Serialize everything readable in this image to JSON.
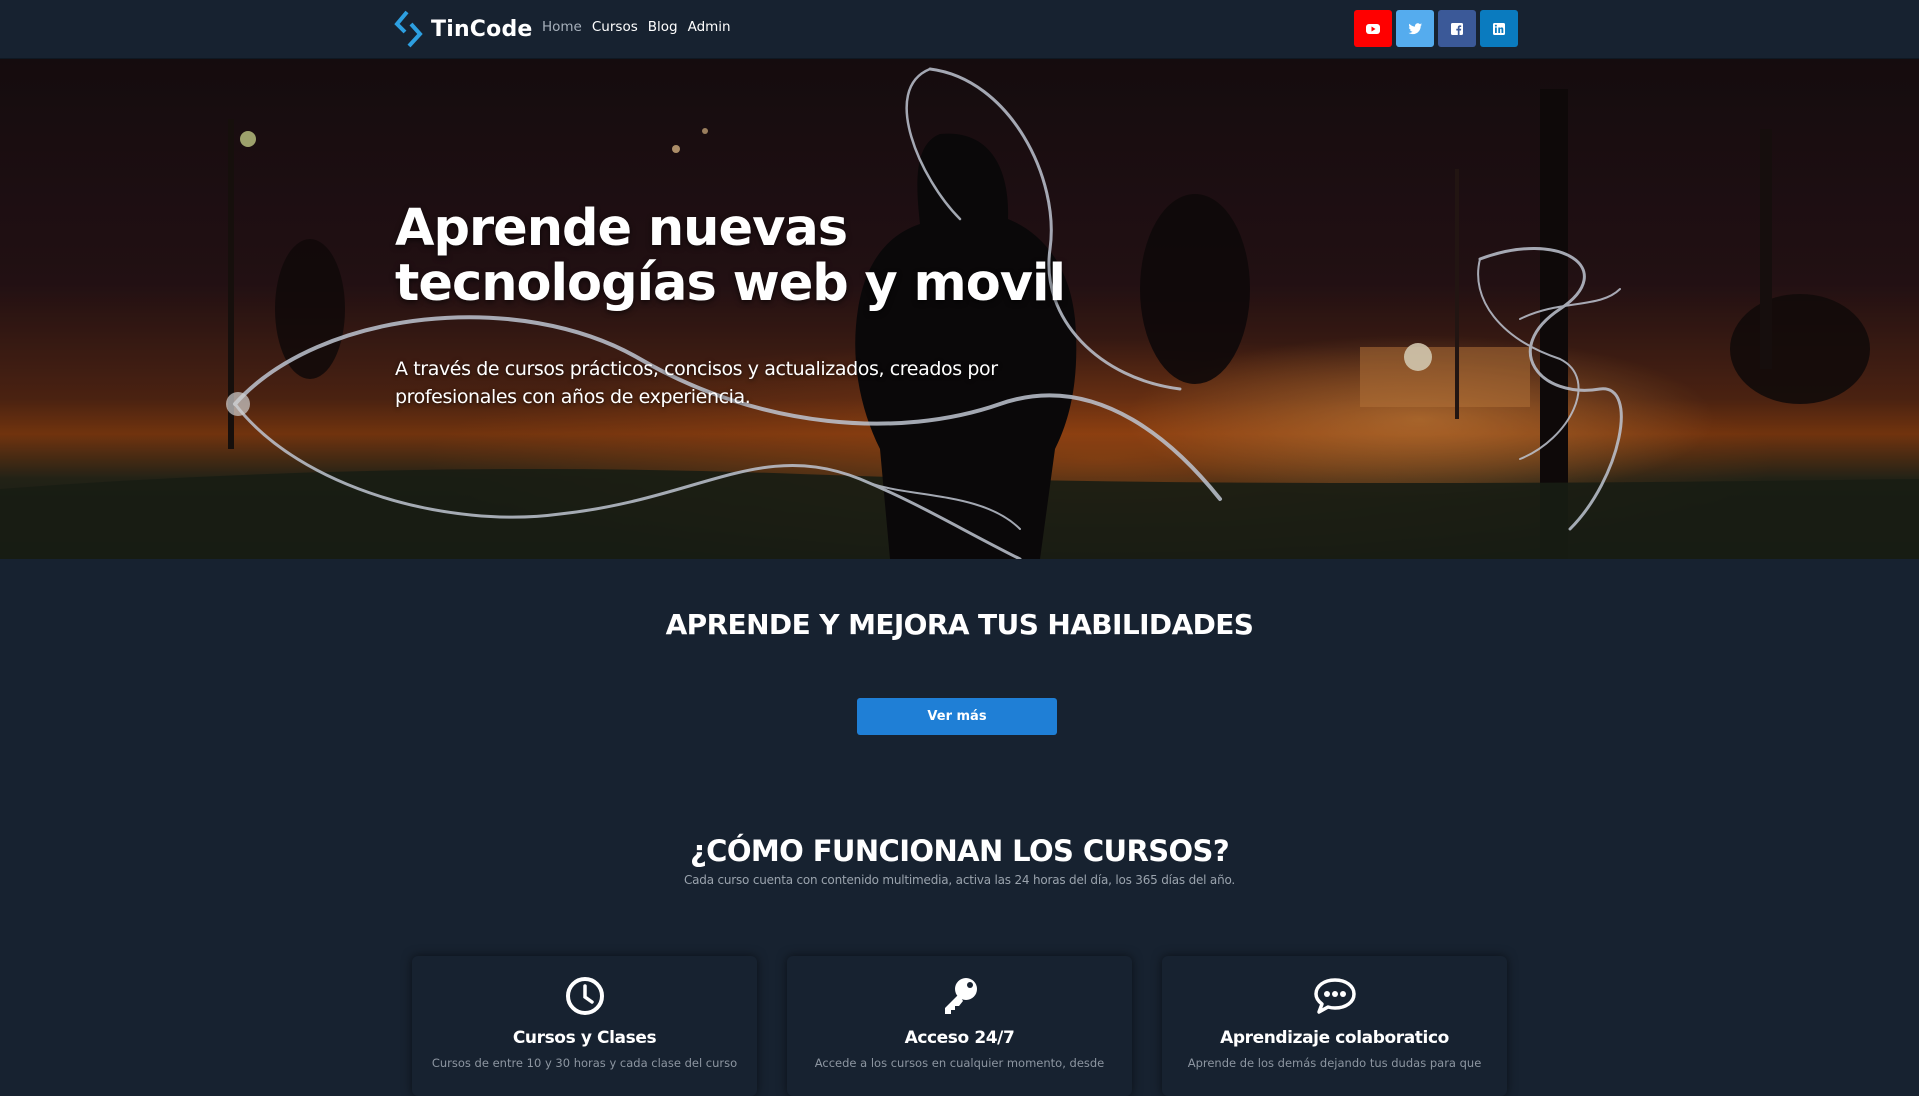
{
  "header": {
    "brand": "TinCode",
    "nav": [
      {
        "label": "Home",
        "active": true
      },
      {
        "label": "Cursos",
        "active": false
      },
      {
        "label": "Blog",
        "active": false
      },
      {
        "label": "Admin",
        "active": false
      }
    ],
    "socials": [
      {
        "name": "youtube-icon",
        "color": "#ff0000"
      },
      {
        "name": "twitter-icon",
        "color": "#55acee"
      },
      {
        "name": "facebook-icon",
        "color": "#3b5998"
      },
      {
        "name": "linkedin-icon",
        "color": "#0a7bbf"
      }
    ]
  },
  "hero": {
    "title_line1": "Aprende nuevas",
    "title_line2": "tecnologías web y movil",
    "subtitle": "A través de cursos prácticos, concisos y actualizados, creados por profesionales con años de experiencia."
  },
  "skills": {
    "title": "APRENDE Y MEJORA TUS HABILIDADES",
    "button": "Ver más"
  },
  "how": {
    "title": "¿CÓMO FUNCIONAN LOS CURSOS?",
    "subtitle": "Cada curso cuenta con contenido multimedia, activa las 24 horas del día, los 365 días del año.",
    "cards": [
      {
        "icon": "clock-icon",
        "title": "Cursos y Clases",
        "text": "Cursos de entre 10 y 30 horas y cada clase del curso"
      },
      {
        "icon": "key-icon",
        "title": "Acceso 24/7",
        "text": "Accede a los cursos en cualquier momento, desde"
      },
      {
        "icon": "chat-icon",
        "title": "Aprendizaje colaboratico",
        "text": "Aprende de los demás dejando tus dudas para que"
      }
    ]
  },
  "colors": {
    "background": "#172230",
    "accent": "#1f7fd6",
    "muted_text": "#9aa3ad"
  }
}
